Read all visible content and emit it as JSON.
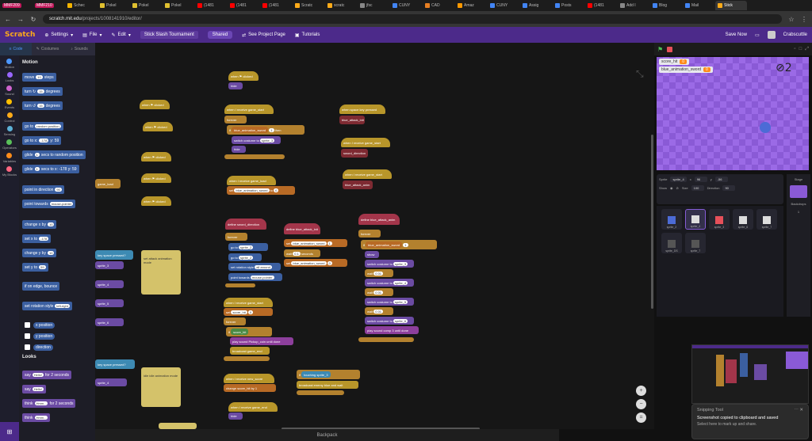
{
  "browser": {
    "tabs": [
      {
        "label": "MMF209",
        "badge": true,
        "color": "#c2185b"
      },
      {
        "label": "MMF210",
        "badge": true,
        "color": "#c2185b"
      },
      {
        "label": "Schec",
        "color": "#f4b400"
      },
      {
        "label": "Pokel",
        "color": "#e0c030"
      },
      {
        "label": "Pokel",
        "color": "#e0c030"
      },
      {
        "label": "Pokel",
        "color": "#e0c030"
      },
      {
        "label": "(1481",
        "color": "#ff0000"
      },
      {
        "label": "(1481",
        "color": "#ff0000"
      },
      {
        "label": "(1481",
        "color": "#ff0000"
      },
      {
        "label": "Scratc",
        "color": "#ffab19"
      },
      {
        "label": "scratc",
        "color": "#ffab19"
      },
      {
        "label": "jfsc",
        "color": "#888"
      },
      {
        "label": "CUNY",
        "color": "#4285f4"
      },
      {
        "label": "CAD",
        "color": "#e67e22"
      },
      {
        "label": "Amaz",
        "color": "#ff9900"
      },
      {
        "label": "CUNY",
        "color": "#4285f4"
      },
      {
        "label": "Assig",
        "color": "#4285f4"
      },
      {
        "label": "Posts",
        "color": "#4285f4"
      },
      {
        "label": "(1481",
        "color": "#ff0000"
      },
      {
        "label": "Add I",
        "color": "#888"
      },
      {
        "label": "Blog",
        "color": "#4285f4"
      },
      {
        "label": "Mail",
        "color": "#4285f4"
      },
      {
        "label": "Stick",
        "color": "#ffab19",
        "active": true
      }
    ],
    "url_host": "scratch.mit.edu",
    "url_path": "/projects/1008141910/editor/"
  },
  "menubar": {
    "logo": "Scratch",
    "settings": "Settings",
    "file": "File",
    "edit": "Edit",
    "project_title": "Stick Slash Tournament",
    "share": "Shared",
    "see_project": "See Project Page",
    "tutorials": "Tutorials",
    "save_now": "Save Now",
    "username": "Crabscuttle"
  },
  "editor_tabs": {
    "code": "Code",
    "costumes": "Costumes",
    "sounds": "Sounds"
  },
  "categories": [
    {
      "label": "Motion",
      "color": "#4c97ff"
    },
    {
      "label": "Looks",
      "color": "#9966ff"
    },
    {
      "label": "Sound",
      "color": "#cf63cf"
    },
    {
      "label": "Events",
      "color": "#ffbf00"
    },
    {
      "label": "Control",
      "color": "#ffab19"
    },
    {
      "label": "Sensing",
      "color": "#5cb1d6"
    },
    {
      "label": "Operators",
      "color": "#59c059"
    },
    {
      "label": "Variables",
      "color": "#ff8c1a"
    },
    {
      "label": "My Blocks",
      "color": "#ff6680"
    }
  ],
  "palette": {
    "motion_header": "Motion",
    "looks_header": "Looks",
    "motion_blocks": [
      {
        "text": "move",
        "input": "10",
        "suffix": "steps"
      },
      {
        "text": "turn ↻",
        "input": "15",
        "suffix": "degrees"
      },
      {
        "text": "turn ↺",
        "input": "15",
        "suffix": "degrees"
      },
      {
        "text": "go to",
        "input": "random position",
        "suffix": ""
      },
      {
        "text": "go to x:",
        "input": "-178",
        "suffix": "y: 59"
      },
      {
        "text": "glide",
        "input": "1",
        "suffix": "secs to random position"
      },
      {
        "text": "glide",
        "input": "1",
        "suffix": "secs to x: -178 y: 59"
      },
      {
        "text": "point in direction",
        "input": "90",
        "suffix": ""
      },
      {
        "text": "point towards",
        "input": "mouse-pointer",
        "suffix": ""
      },
      {
        "text": "change x by",
        "input": "10",
        "suffix": ""
      },
      {
        "text": "set x to",
        "input": "-178",
        "suffix": ""
      },
      {
        "text": "change y by",
        "input": "10",
        "suffix": ""
      },
      {
        "text": "set y to",
        "input": "59",
        "suffix": ""
      },
      {
        "text": "if on edge, bounce",
        "input": "",
        "suffix": ""
      },
      {
        "text": "set rotation style",
        "input": "left-right",
        "suffix": ""
      }
    ],
    "reporters": [
      "x position",
      "y position",
      "direction"
    ],
    "looks_blocks": [
      {
        "text": "say",
        "input": "Hello!",
        "suffix": "for 2 seconds"
      },
      {
        "text": "say",
        "input": "Hello!",
        "suffix": ""
      },
      {
        "text": "think",
        "input": "Hmm...",
        "suffix": "for 2 seconds"
      },
      {
        "text": "think",
        "input": "Hmm...",
        "suffix": ""
      }
    ]
  },
  "scripts": {
    "when_flag_clicked": "when ⚑ clicked",
    "hide": "hide",
    "when_receive_game_start": "when I receive game_start",
    "forever": "forever",
    "if_then": "if",
    "then": "then",
    "blue_animation_sword": "blue_animation_sword",
    "switch_costume_to": "switch costume to",
    "sprite_3": "sprite_3",
    "when_receive_game_load": "when I receive game_load",
    "set_var": "set",
    "when_space_pressed": "when space key pressed",
    "blue_attack_init": "blue_attack_init",
    "sword_direction": "sword_direction",
    "blue_attack_anim": "blue_attack_anim",
    "define_sword_direction": "define sword_direction",
    "define_blue_attack_init": "define blue_attack_init",
    "define_blue_attack_anim": "define blue_attack_anim",
    "go_to": "go to",
    "sprite_2": "sprite_2",
    "set_rotation_style": "set rotation style",
    "all_around": "all around",
    "point_towards": "point towards",
    "mouse_pointer": "mouse-pointer",
    "wait": "wait",
    "seconds": "seconds",
    "to": "to",
    "show": "show",
    "sprite_4": "sprite_4",
    "sprite_5": "sprite_5",
    "sprite_6": "sprite_6",
    "play_sound_comp": "play sound comp 3 until done",
    "score_hit": "score_hit",
    "broadcast_game_end": "broadcast game_end",
    "play_sound_pickup": "play sound Pickup_coin until done",
    "touching": "touching",
    "broadcast_enemy_blue": "broadcast enemy blue and wait",
    "when_receive_new_score": "when I receive new_score",
    "change_score_hit": "change score_hit by 1",
    "when_receive_game_end": "when I receive game_end",
    "note_1": "set attack animation mode",
    "note_2": "idle idle animation mode",
    "game_load": "game_load",
    "key_pressed": "key space pressed?",
    "number_0": "0",
    "number_1": "1",
    "number_01": "0.1",
    "number_001": "0.01"
  },
  "backpack": "Backpack",
  "stage": {
    "monitor_1_label": "score_hit",
    "monitor_1_value": "0",
    "monitor_2_label": "blue_animation_sword",
    "monitor_2_value": "0",
    "deco": "⊘2"
  },
  "sprite_info": {
    "sprite_label": "Sprite",
    "sprite_name": "sprite_4",
    "x_label": "x",
    "x_val": "96",
    "y_label": "y",
    "y_val": "-56",
    "show_label": "Show",
    "size_label": "Size",
    "size_val": "100",
    "direction_label": "Direction",
    "direction_val": "90"
  },
  "sprites": [
    {
      "name": "sprite_2",
      "color": "#4c6bd6",
      "selected": false
    },
    {
      "name": "sprite_4",
      "color": "#dddddd",
      "selected": true
    },
    {
      "name": "sprite_3",
      "color": "#e6505a",
      "selected": false
    },
    {
      "name": "sprite_6",
      "color": "#dddddd",
      "selected": false
    },
    {
      "name": "sprite_7",
      "color": "#dddddd",
      "selected": false
    },
    {
      "name": "sprite_DS",
      "color": "#555555",
      "selected": false
    },
    {
      "name": "sprite_7",
      "color": "#555555",
      "selected": false
    }
  ],
  "stage_pane": {
    "label": "Stage",
    "backdrops_label": "Backdrops",
    "backdrops_count": "1"
  },
  "toast": {
    "app": "Snipping Tool",
    "title": "Screenshot copied to clipboard and saved",
    "subtitle": "Select here to mark up and share."
  }
}
